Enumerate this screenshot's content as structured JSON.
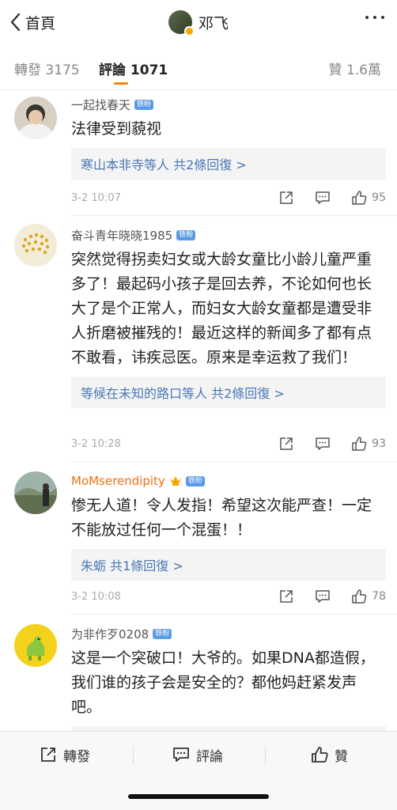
{
  "nav": {
    "back_label": "首頁",
    "title": "邓飞"
  },
  "tabs": {
    "reposts": "轉發 3175",
    "comments": "評論 1071",
    "likes": "贊 1.6萬",
    "accent": "#ff8200"
  },
  "fan_badge": "铁粉",
  "comments": [
    {
      "name": "一起找春天",
      "text": "法律受到藐视",
      "reply_summary": "寒山本非寺等人 共2條回復 >",
      "time": "3-2 10:07",
      "likes": "95"
    },
    {
      "name": "奋斗青年晓晓1985",
      "text": "突然觉得拐卖妇女或大龄女童比小龄儿童严重多了！最起码小孩子是回去养，不论如何也长大了是个正常人，而妇女大龄女童都是遭受非人折磨被摧残的！最近这样的新闻多了都有点不敢看，讳疾忌医。原来是幸运救了我们！",
      "reply_summary": "等候在未知的路口等人 共2條回復 >",
      "time": "3-2 10:28",
      "likes": "93"
    },
    {
      "name": "MoMserendipity",
      "text": "惨无人道！令人发指！希望这次能严查！一定不能放过任何一个混蛋！！",
      "reply_summary": "朱蛎  共1條回復 >",
      "time": "3-2 10:08",
      "likes": "78"
    },
    {
      "name": "为非作歹0208",
      "text": "这是一个突破口！大爷的。如果DNA都造假，我们谁的孩子会是安全的？都他妈赶紧发声吧。"
    }
  ],
  "toolbar": {
    "repost": "轉發",
    "comment": "評論",
    "like": "贊"
  },
  "colors": {
    "link": "#4a79b5",
    "vip_name": "#f86d0c",
    "badge": "#5b9be6"
  }
}
